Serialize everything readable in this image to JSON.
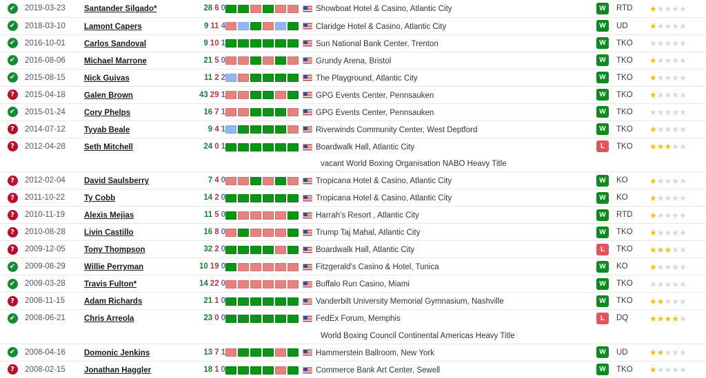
{
  "columns": {
    "status": "status",
    "date": "date",
    "opponent": "opponent",
    "record": "opponent record",
    "streak": "last six",
    "venue": "venue",
    "result": "result",
    "method": "method",
    "rating": "rating"
  },
  "icons": {
    "verified": "check-circle-icon",
    "unknown": "question-circle-icon",
    "flag": "us-flag-icon",
    "star": "star-icon"
  },
  "colors": {
    "win_green": "#0b9415",
    "loss_red": "#e5827f",
    "draw_blue": "#8fb8f0",
    "badge_win": "#0b8a1e",
    "badge_loss": "#e0555a",
    "status_ok": "#138c32",
    "status_unknown": "#bb0c2b",
    "star_on": "#f2c014",
    "star_off": "#d8d8d8",
    "record_w": "#1f7a33",
    "record_l": "#cc3333",
    "record_d": "#4f6fb5"
  },
  "glyphs": {
    "check": "✔",
    "question": "?",
    "star": "★"
  },
  "rows": [
    {
      "status": "ok",
      "date": "2019-03-23",
      "opponent": "Santander Silgado*",
      "w": "28",
      "l": "6",
      "d": "0",
      "streak": [
        "w",
        "w",
        "l",
        "w",
        "l",
        "l"
      ],
      "venue": "Showboat Hotel & Casino, Atlantic City",
      "result": "W",
      "method": "RTD",
      "rating": 1,
      "title": ""
    },
    {
      "status": "ok",
      "date": "2018-03-10",
      "opponent": "Lamont Capers",
      "w": "9",
      "l": "11",
      "d": "4",
      "streak": [
        "l",
        "d",
        "w",
        "l",
        "d",
        "w"
      ],
      "venue": "Claridge Hotel & Casino, Atlantic City",
      "result": "W",
      "method": "UD",
      "rating": 1,
      "title": ""
    },
    {
      "status": "ok",
      "date": "2016-10-01",
      "opponent": "Carlos Sandoval",
      "w": "9",
      "l": "10",
      "d": "1",
      "streak": [
        "w",
        "w",
        "w",
        "w",
        "w",
        "w"
      ],
      "venue": "Sun National Bank Center, Trenton",
      "result": "W",
      "method": "TKO",
      "rating": 0,
      "title": ""
    },
    {
      "status": "ok",
      "date": "2016-08-06",
      "opponent": "Michael Marrone",
      "w": "21",
      "l": "5",
      "d": "0",
      "streak": [
        "l",
        "l",
        "w",
        "l",
        "w",
        "l"
      ],
      "venue": "Grundy Arena, Bristol",
      "result": "W",
      "method": "TKO",
      "rating": 1,
      "title": ""
    },
    {
      "status": "ok",
      "date": "2015-08-15",
      "opponent": "Nick Guivas",
      "w": "11",
      "l": "2",
      "d": "2",
      "streak": [
        "d",
        "l",
        "w",
        "w",
        "w",
        "w"
      ],
      "venue": "The Playground, Atlantic City",
      "result": "W",
      "method": "TKO",
      "rating": 1,
      "title": ""
    },
    {
      "status": "unknown",
      "date": "2015-04-18",
      "opponent": "Galen Brown",
      "w": "43",
      "l": "29",
      "d": "1",
      "streak": [
        "l",
        "l",
        "w",
        "w",
        "l",
        "w"
      ],
      "venue": "GPG Events Center, Pennsauken",
      "result": "W",
      "method": "TKO",
      "rating": 1,
      "title": ""
    },
    {
      "status": "ok",
      "date": "2015-01-24",
      "opponent": "Cory Phelps",
      "w": "16",
      "l": "7",
      "d": "1",
      "streak": [
        "l",
        "l",
        "w",
        "w",
        "w",
        "l"
      ],
      "venue": "GPG Events Center, Pennsauken",
      "result": "W",
      "method": "TKO",
      "rating": 0,
      "title": ""
    },
    {
      "status": "unknown",
      "date": "2014-07-12",
      "opponent": "Tyyab Beale",
      "w": "9",
      "l": "4",
      "d": "1",
      "streak": [
        "d",
        "w",
        "w",
        "w",
        "w",
        "l"
      ],
      "venue": "Riverwinds Community Center, West Deptford",
      "result": "W",
      "method": "TKO",
      "rating": 1,
      "title": ""
    },
    {
      "status": "unknown",
      "date": "2012-04-28",
      "opponent": "Seth Mitchell",
      "w": "24",
      "l": "0",
      "d": "1",
      "streak": [
        "w",
        "w",
        "w",
        "w",
        "w",
        "w"
      ],
      "venue": "Boardwalk Hall, Atlantic City",
      "result": "L",
      "method": "TKO",
      "rating": 3,
      "title": "vacant World Boxing Organisation NABO Heavy Title"
    },
    {
      "status": "unknown",
      "date": "2012-02-04",
      "opponent": "David Saulsberry",
      "w": "7",
      "l": "4",
      "d": "0",
      "streak": [
        "l",
        "l",
        "w",
        "l",
        "w",
        "l"
      ],
      "venue": "Tropicana Hotel & Casino, Atlantic City",
      "result": "W",
      "method": "KO",
      "rating": 1,
      "title": ""
    },
    {
      "status": "unknown",
      "date": "2011-10-22",
      "opponent": "Ty Cobb",
      "w": "14",
      "l": "2",
      "d": "0",
      "streak": [
        "w",
        "w",
        "w",
        "w",
        "w",
        "w"
      ],
      "venue": "Tropicana Hotel & Casino, Atlantic City",
      "result": "W",
      "method": "KO",
      "rating": 1,
      "title": ""
    },
    {
      "status": "unknown",
      "date": "2010-11-19",
      "opponent": "Alexis Mejias",
      "w": "11",
      "l": "5",
      "d": "0",
      "streak": [
        "w",
        "l",
        "l",
        "l",
        "l",
        "w"
      ],
      "venue": "Harrah's Resort , Atlantic City",
      "result": "W",
      "method": "RTD",
      "rating": 1,
      "title": ""
    },
    {
      "status": "unknown",
      "date": "2010-08-28",
      "opponent": "Livin Castillo",
      "w": "16",
      "l": "8",
      "d": "0",
      "streak": [
        "l",
        "w",
        "l",
        "l",
        "l",
        "w"
      ],
      "venue": "Trump Taj Mahal, Atlantic City",
      "result": "W",
      "method": "TKO",
      "rating": 1,
      "title": ""
    },
    {
      "status": "unknown",
      "date": "2009-12-05",
      "opponent": "Tony Thompson",
      "w": "32",
      "l": "2",
      "d": "0",
      "streak": [
        "w",
        "w",
        "w",
        "w",
        "l",
        "w"
      ],
      "venue": "Boardwalk Hall, Atlantic City",
      "result": "L",
      "method": "TKO",
      "rating": 3,
      "title": ""
    },
    {
      "status": "ok",
      "date": "2009-08-29",
      "opponent": "Willie Perryman",
      "w": "10",
      "l": "19",
      "d": "0",
      "streak": [
        "w",
        "l",
        "l",
        "l",
        "l",
        "l"
      ],
      "venue": "Fitzgerald's Casino & Hotel, Tunica",
      "result": "W",
      "method": "KO",
      "rating": 1,
      "title": ""
    },
    {
      "status": "ok",
      "date": "2009-03-28",
      "opponent": "Travis Fulton*",
      "w": "14",
      "l": "22",
      "d": "0",
      "streak": [
        "l",
        "l",
        "l",
        "l",
        "l",
        "l"
      ],
      "venue": "Buffalo Run Casino, Miami",
      "result": "W",
      "method": "TKO",
      "rating": 0,
      "title": ""
    },
    {
      "status": "unknown",
      "date": "2008-11-15",
      "opponent": "Adam Richards",
      "w": "21",
      "l": "1",
      "d": "0",
      "streak": [
        "w",
        "w",
        "w",
        "w",
        "w",
        "w"
      ],
      "venue": "Vanderbilt University Memorial Gymnasium, Nashville",
      "result": "W",
      "method": "TKO",
      "rating": 2,
      "title": ""
    },
    {
      "status": "ok",
      "date": "2008-06-21",
      "opponent": "Chris Arreola",
      "w": "23",
      "l": "0",
      "d": "0",
      "streak": [
        "w",
        "w",
        "w",
        "w",
        "w",
        "w"
      ],
      "venue": "FedEx Forum, Memphis",
      "result": "L",
      "method": "DQ",
      "rating": 4,
      "title": "World Boxing Council Continental Americas Heavy Title"
    },
    {
      "status": "ok",
      "date": "2008-04-16",
      "opponent": "Domonic Jenkins",
      "w": "13",
      "l": "7",
      "d": "1",
      "streak": [
        "l",
        "w",
        "w",
        "w",
        "l",
        "w"
      ],
      "venue": "Hammerstein Ballroom, New York",
      "result": "W",
      "method": "UD",
      "rating": 2,
      "title": ""
    },
    {
      "status": "unknown",
      "date": "2008-02-15",
      "opponent": "Jonathan Haggler",
      "w": "18",
      "l": "1",
      "d": "0",
      "streak": [
        "w",
        "w",
        "w",
        "w",
        "l",
        "w"
      ],
      "venue": "Commerce Bank Art Center, Sewell",
      "result": "W",
      "method": "TKO",
      "rating": 1,
      "title": ""
    }
  ]
}
